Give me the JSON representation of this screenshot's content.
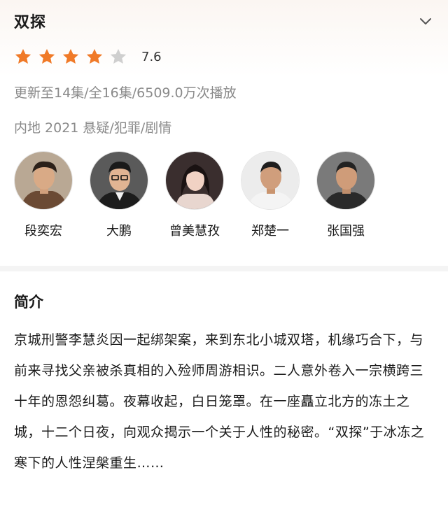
{
  "show": {
    "title": "双探",
    "rating": 7.6,
    "rating_display": "7.6",
    "stars": {
      "filled": 4,
      "total": 5
    },
    "episode_info": "更新至14集/全16集/6509.0万次播放",
    "tags": "内地 2021 悬疑/犯罪/剧情"
  },
  "cast": [
    {
      "name": "段奕宏"
    },
    {
      "name": "大鹏"
    },
    {
      "name": "曾美慧孜"
    },
    {
      "name": "郑楚一"
    },
    {
      "name": "张国强"
    }
  ],
  "intro": {
    "heading": "简介",
    "text": "京城刑警李慧炎因一起绑架案，来到东北小城双塔，机缘巧合下，与前来寻找父亲被杀真相的入殓师周游相识。二人意外卷入一宗横跨三十年的恩怨纠葛。夜幕收起，白日笼罩。在一座矗立北方的冻土之城，十二个日夜，向观众揭示一个关于人性的秘密。“双探”于冰冻之寒下的人性涅槃重生……"
  },
  "colors": {
    "star_filled": "#f07a28",
    "star_empty": "#cfcfcf",
    "meta_text": "#8a8a8a"
  },
  "icons": {
    "collapse": "chevron-down-icon",
    "star": "star-icon"
  }
}
